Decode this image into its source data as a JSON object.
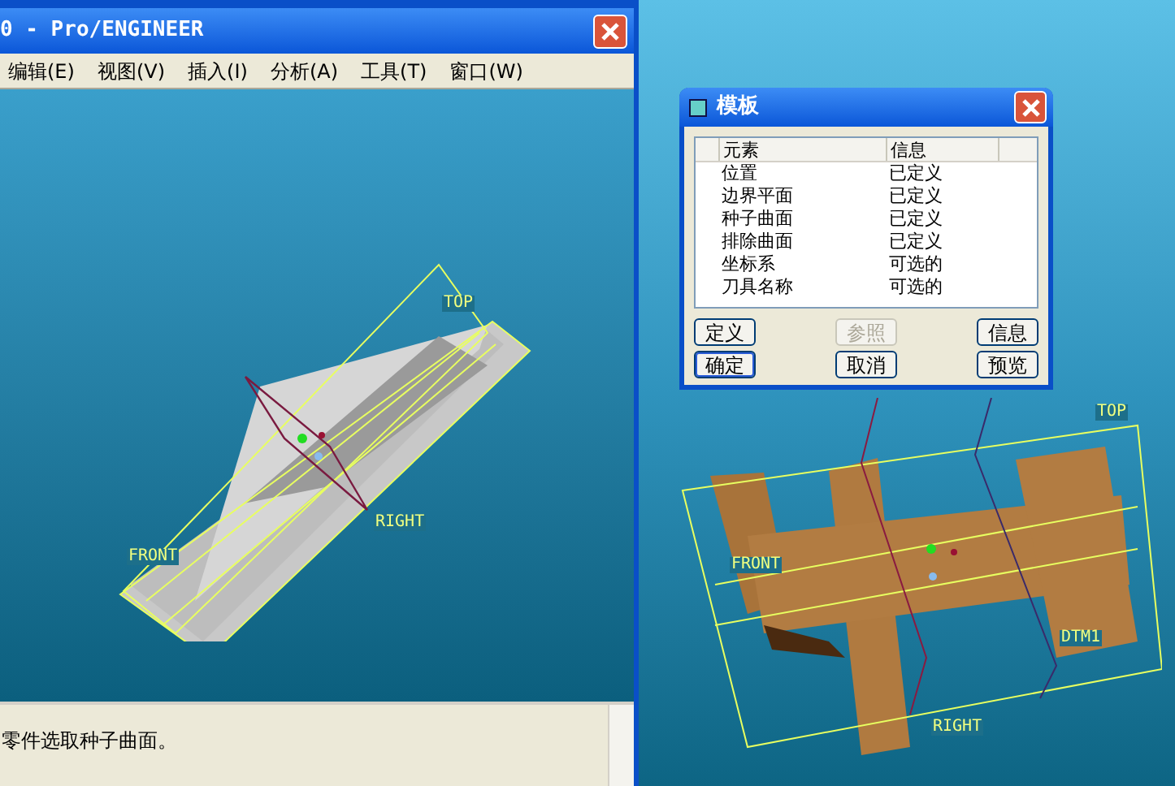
{
  "main_window": {
    "title": "0 - Pro/ENGINEER",
    "menu": [
      "编辑(E)",
      "视图(V)",
      "插入(I)",
      "分析(A)",
      "工具(T)",
      "窗口(W)"
    ],
    "viewport": {
      "datum_labels": [
        "TOP",
        "RIGHT",
        "FRONT"
      ]
    },
    "message": "零件选取种子曲面。"
  },
  "second_viewport": {
    "datum_labels": [
      "TOP",
      "FRONT",
      "DTM1",
      "RIGHT"
    ]
  },
  "dialog": {
    "title": "模板",
    "columns": [
      "元素",
      "信息"
    ],
    "rows": [
      {
        "element": "位置",
        "info": "已定义"
      },
      {
        "element": "边界平面",
        "info": "已定义"
      },
      {
        "element": "种子曲面",
        "info": "已定义"
      },
      {
        "element": "排除曲面",
        "info": "已定义"
      },
      {
        "element": "坐标系",
        "info": "可选的"
      },
      {
        "element": "刀具名称",
        "info": "可选的"
      }
    ],
    "buttons": [
      {
        "label": "定义",
        "disabled": false,
        "focused": false
      },
      {
        "label": "参照",
        "disabled": true,
        "focused": false
      },
      {
        "label": "信息",
        "disabled": false,
        "focused": false
      },
      {
        "label": "确定",
        "disabled": false,
        "focused": true
      },
      {
        "label": "取消",
        "disabled": false,
        "focused": false
      },
      {
        "label": "预览",
        "disabled": false,
        "focused": false
      }
    ]
  }
}
